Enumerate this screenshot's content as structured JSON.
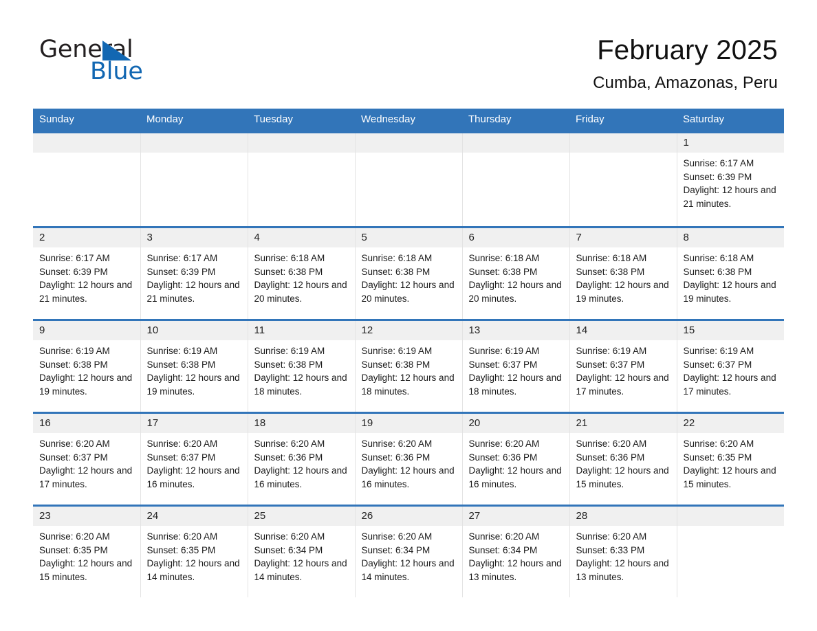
{
  "brand": {
    "logo_text_primary": "General",
    "logo_text_secondary": "Blue",
    "logo_color": "#1267b2",
    "triangle_icon": "triangle-icon"
  },
  "header": {
    "title": "February 2025",
    "subtitle": "Cumba, Amazonas, Peru"
  },
  "calendar": {
    "header_bg": "#3275b9",
    "daynum_bg": "#f0f0f0",
    "weekdays": [
      "Sunday",
      "Monday",
      "Tuesday",
      "Wednesday",
      "Thursday",
      "Friday",
      "Saturday"
    ],
    "weeks": [
      [
        {
          "day": "",
          "sunrise": "",
          "sunset": "",
          "daylight": "",
          "empty": true
        },
        {
          "day": "",
          "sunrise": "",
          "sunset": "",
          "daylight": "",
          "empty": true
        },
        {
          "day": "",
          "sunrise": "",
          "sunset": "",
          "daylight": "",
          "empty": true
        },
        {
          "day": "",
          "sunrise": "",
          "sunset": "",
          "daylight": "",
          "empty": true
        },
        {
          "day": "",
          "sunrise": "",
          "sunset": "",
          "daylight": "",
          "empty": true
        },
        {
          "day": "",
          "sunrise": "",
          "sunset": "",
          "daylight": "",
          "empty": true
        },
        {
          "day": "1",
          "sunrise": "Sunrise: 6:17 AM",
          "sunset": "Sunset: 6:39 PM",
          "daylight": "Daylight: 12 hours and 21 minutes.",
          "empty": false
        }
      ],
      [
        {
          "day": "2",
          "sunrise": "Sunrise: 6:17 AM",
          "sunset": "Sunset: 6:39 PM",
          "daylight": "Daylight: 12 hours and 21 minutes.",
          "empty": false
        },
        {
          "day": "3",
          "sunrise": "Sunrise: 6:17 AM",
          "sunset": "Sunset: 6:39 PM",
          "daylight": "Daylight: 12 hours and 21 minutes.",
          "empty": false
        },
        {
          "day": "4",
          "sunrise": "Sunrise: 6:18 AM",
          "sunset": "Sunset: 6:38 PM",
          "daylight": "Daylight: 12 hours and 20 minutes.",
          "empty": false
        },
        {
          "day": "5",
          "sunrise": "Sunrise: 6:18 AM",
          "sunset": "Sunset: 6:38 PM",
          "daylight": "Daylight: 12 hours and 20 minutes.",
          "empty": false
        },
        {
          "day": "6",
          "sunrise": "Sunrise: 6:18 AM",
          "sunset": "Sunset: 6:38 PM",
          "daylight": "Daylight: 12 hours and 20 minutes.",
          "empty": false
        },
        {
          "day": "7",
          "sunrise": "Sunrise: 6:18 AM",
          "sunset": "Sunset: 6:38 PM",
          "daylight": "Daylight: 12 hours and 19 minutes.",
          "empty": false
        },
        {
          "day": "8",
          "sunrise": "Sunrise: 6:18 AM",
          "sunset": "Sunset: 6:38 PM",
          "daylight": "Daylight: 12 hours and 19 minutes.",
          "empty": false
        }
      ],
      [
        {
          "day": "9",
          "sunrise": "Sunrise: 6:19 AM",
          "sunset": "Sunset: 6:38 PM",
          "daylight": "Daylight: 12 hours and 19 minutes.",
          "empty": false
        },
        {
          "day": "10",
          "sunrise": "Sunrise: 6:19 AM",
          "sunset": "Sunset: 6:38 PM",
          "daylight": "Daylight: 12 hours and 19 minutes.",
          "empty": false
        },
        {
          "day": "11",
          "sunrise": "Sunrise: 6:19 AM",
          "sunset": "Sunset: 6:38 PM",
          "daylight": "Daylight: 12 hours and 18 minutes.",
          "empty": false
        },
        {
          "day": "12",
          "sunrise": "Sunrise: 6:19 AM",
          "sunset": "Sunset: 6:38 PM",
          "daylight": "Daylight: 12 hours and 18 minutes.",
          "empty": false
        },
        {
          "day": "13",
          "sunrise": "Sunrise: 6:19 AM",
          "sunset": "Sunset: 6:37 PM",
          "daylight": "Daylight: 12 hours and 18 minutes.",
          "empty": false
        },
        {
          "day": "14",
          "sunrise": "Sunrise: 6:19 AM",
          "sunset": "Sunset: 6:37 PM",
          "daylight": "Daylight: 12 hours and 17 minutes.",
          "empty": false
        },
        {
          "day": "15",
          "sunrise": "Sunrise: 6:19 AM",
          "sunset": "Sunset: 6:37 PM",
          "daylight": "Daylight: 12 hours and 17 minutes.",
          "empty": false
        }
      ],
      [
        {
          "day": "16",
          "sunrise": "Sunrise: 6:20 AM",
          "sunset": "Sunset: 6:37 PM",
          "daylight": "Daylight: 12 hours and 17 minutes.",
          "empty": false
        },
        {
          "day": "17",
          "sunrise": "Sunrise: 6:20 AM",
          "sunset": "Sunset: 6:37 PM",
          "daylight": "Daylight: 12 hours and 16 minutes.",
          "empty": false
        },
        {
          "day": "18",
          "sunrise": "Sunrise: 6:20 AM",
          "sunset": "Sunset: 6:36 PM",
          "daylight": "Daylight: 12 hours and 16 minutes.",
          "empty": false
        },
        {
          "day": "19",
          "sunrise": "Sunrise: 6:20 AM",
          "sunset": "Sunset: 6:36 PM",
          "daylight": "Daylight: 12 hours and 16 minutes.",
          "empty": false
        },
        {
          "day": "20",
          "sunrise": "Sunrise: 6:20 AM",
          "sunset": "Sunset: 6:36 PM",
          "daylight": "Daylight: 12 hours and 16 minutes.",
          "empty": false
        },
        {
          "day": "21",
          "sunrise": "Sunrise: 6:20 AM",
          "sunset": "Sunset: 6:36 PM",
          "daylight": "Daylight: 12 hours and 15 minutes.",
          "empty": false
        },
        {
          "day": "22",
          "sunrise": "Sunrise: 6:20 AM",
          "sunset": "Sunset: 6:35 PM",
          "daylight": "Daylight: 12 hours and 15 minutes.",
          "empty": false
        }
      ],
      [
        {
          "day": "23",
          "sunrise": "Sunrise: 6:20 AM",
          "sunset": "Sunset: 6:35 PM",
          "daylight": "Daylight: 12 hours and 15 minutes.",
          "empty": false
        },
        {
          "day": "24",
          "sunrise": "Sunrise: 6:20 AM",
          "sunset": "Sunset: 6:35 PM",
          "daylight": "Daylight: 12 hours and 14 minutes.",
          "empty": false
        },
        {
          "day": "25",
          "sunrise": "Sunrise: 6:20 AM",
          "sunset": "Sunset: 6:34 PM",
          "daylight": "Daylight: 12 hours and 14 minutes.",
          "empty": false
        },
        {
          "day": "26",
          "sunrise": "Sunrise: 6:20 AM",
          "sunset": "Sunset: 6:34 PM",
          "daylight": "Daylight: 12 hours and 14 minutes.",
          "empty": false
        },
        {
          "day": "27",
          "sunrise": "Sunrise: 6:20 AM",
          "sunset": "Sunset: 6:34 PM",
          "daylight": "Daylight: 12 hours and 13 minutes.",
          "empty": false
        },
        {
          "day": "28",
          "sunrise": "Sunrise: 6:20 AM",
          "sunset": "Sunset: 6:33 PM",
          "daylight": "Daylight: 12 hours and 13 minutes.",
          "empty": false
        },
        {
          "day": "",
          "sunrise": "",
          "sunset": "",
          "daylight": "",
          "empty": true
        }
      ]
    ]
  }
}
